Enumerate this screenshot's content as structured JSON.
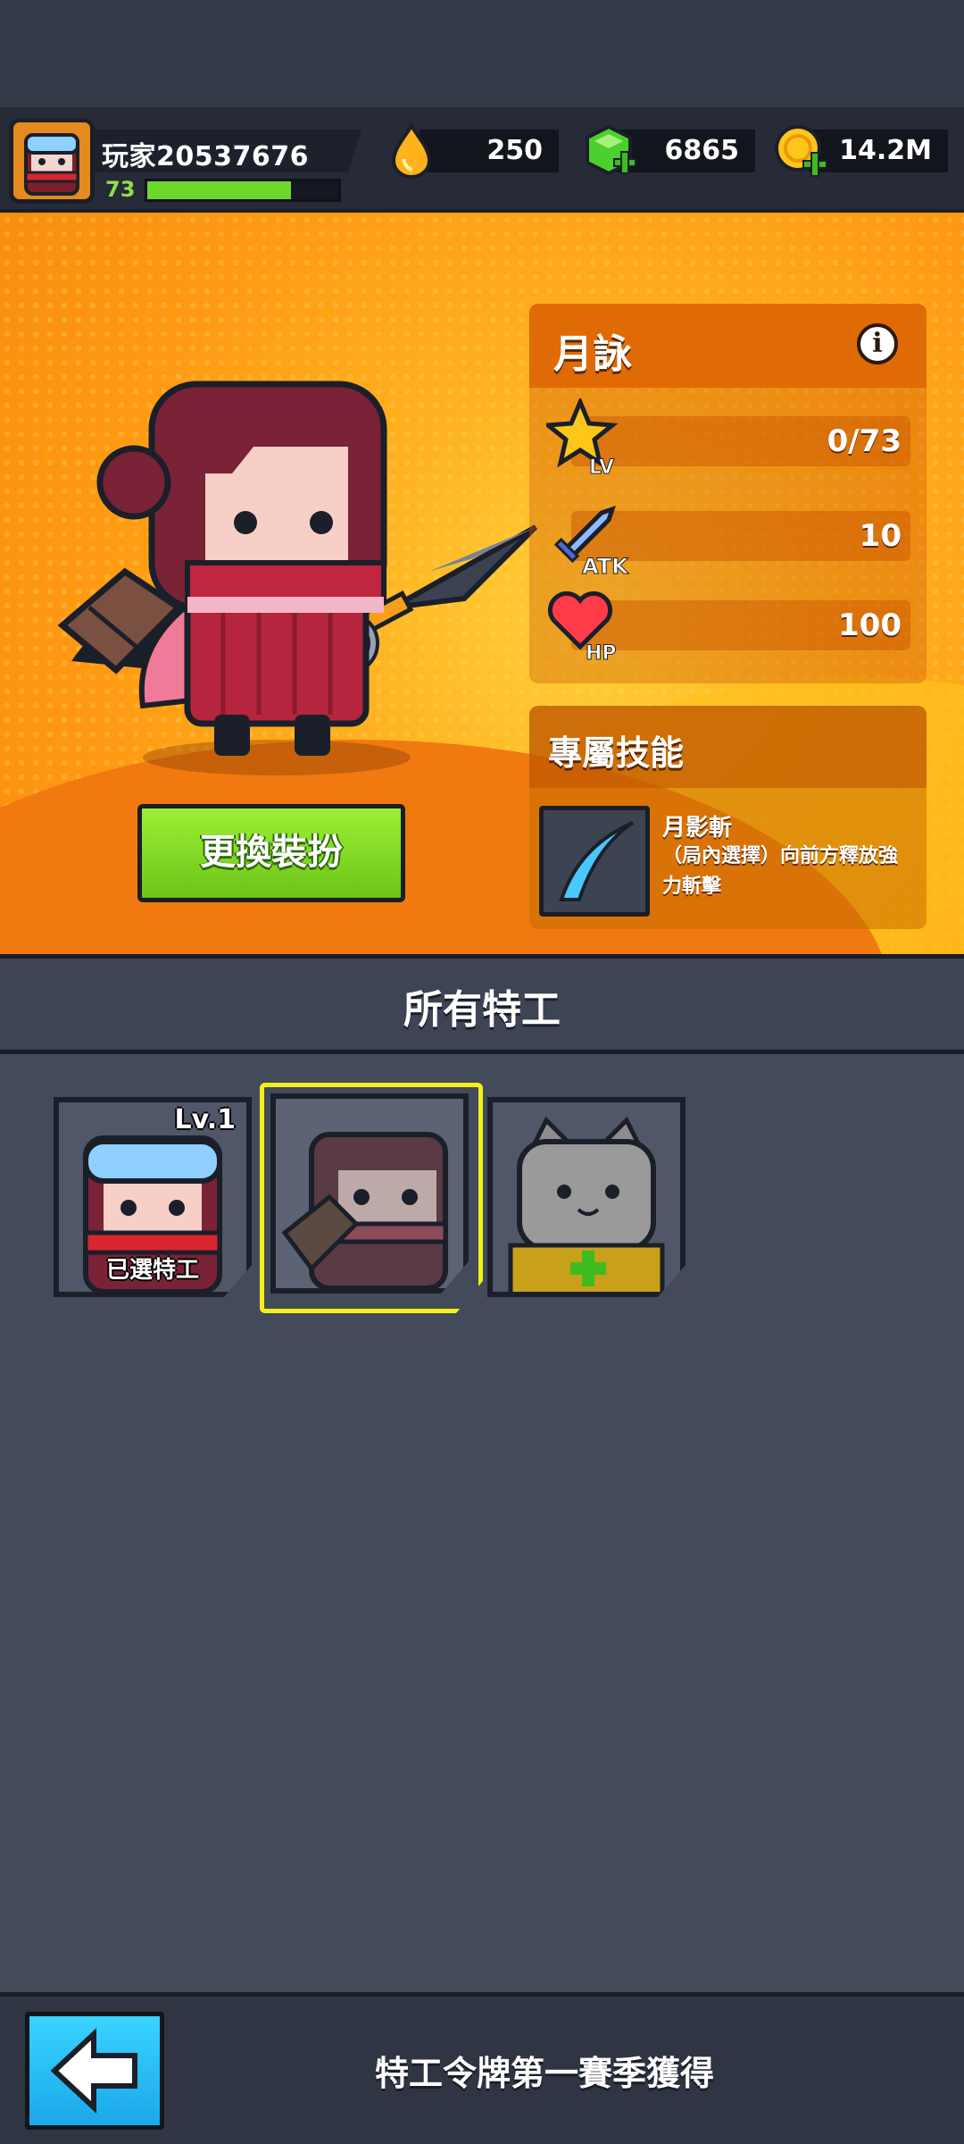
{
  "player": {
    "name": "玩家20537676",
    "level": "73",
    "xp_fraction": 0.75
  },
  "resources": {
    "energy": "250",
    "gems": "6865",
    "gold": "14.2M"
  },
  "agent": {
    "name": "月詠",
    "stats": {
      "lv_label": "LV",
      "lv_value": "0/73",
      "atk_label": "ATK",
      "atk_value": "10",
      "hp_label": "HP",
      "hp_value": "100"
    },
    "skill": {
      "header": "專屬技能",
      "name": "月影斬",
      "description": "（局內選擇）向前方釋放強力斬擊"
    }
  },
  "change_outfit_label": "更換裝扮",
  "list": {
    "title": "所有特工",
    "cards": [
      {
        "level": "Lv.1",
        "badge": "已選特工"
      },
      {
        "level": "",
        "badge": ""
      },
      {
        "level": "",
        "badge": ""
      }
    ]
  },
  "footer": {
    "text": "特工令牌第一賽季獲得"
  },
  "colors": {
    "accent_orange": "#ff9a12",
    "button_green": "#6cc41a",
    "selection_yellow": "#f6ee1a",
    "back_blue": "#1aa8ea"
  }
}
